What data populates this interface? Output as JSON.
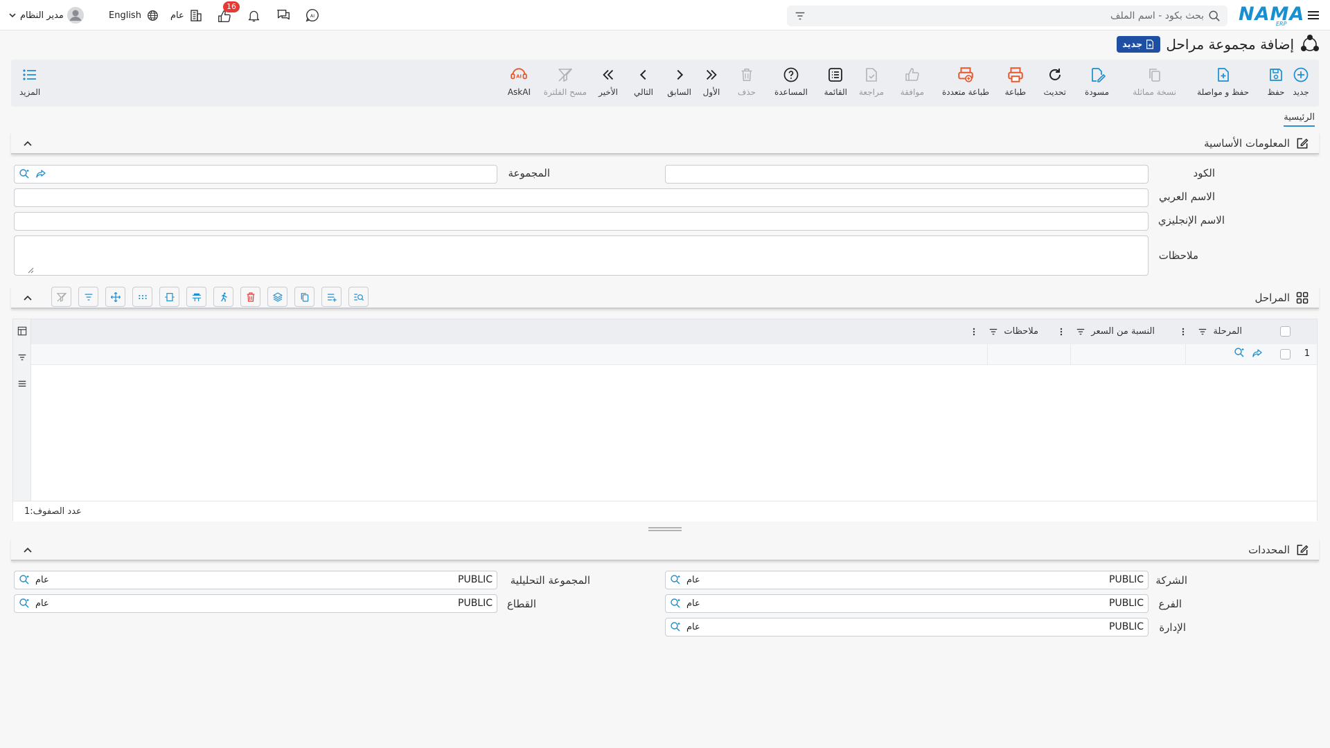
{
  "topbar": {
    "user_name": "مدير النظام",
    "language": "English",
    "scope": "عام",
    "notification_count": "16",
    "search_placeholder": "بحث بكود - اسم الملف",
    "logo_text": "NAMA",
    "logo_sub": "ERP"
  },
  "page": {
    "title": "إضافة مجموعة مراحل",
    "badge": "جديد"
  },
  "toolbar": {
    "new": "جديد",
    "save": "حفظ",
    "save_continue": "حفظ و مواصلة",
    "duplicate": "نسخة مماثلة",
    "draft": "مسودة",
    "refresh": "تحديث",
    "print": "طباعة",
    "multi_print": "طباعة متعددة",
    "approve": "موافقة",
    "review": "مراجعة",
    "list": "القائمة",
    "help": "المساعدة",
    "delete": "حذف",
    "first": "الأول",
    "previous": "السابق",
    "next": "التالي",
    "last": "الأخير",
    "clear_filter": "مسح الفلترة",
    "askai": "AskAI",
    "more": "المزيد"
  },
  "tabs": {
    "main": "الرئيسية"
  },
  "basic_info": {
    "title": "المعلومات الأساسية",
    "code_label": "الكود",
    "group_label": "المجموعة",
    "arabic_name_label": "الاسم العربي",
    "english_name_label": "الاسم الإنجليزي",
    "notes_label": "ملاحظات"
  },
  "stages": {
    "title": "المراحل",
    "columns": {
      "stage": "المرحلة",
      "price_ratio": "النسبة من السعر",
      "notes": "ملاحظات"
    },
    "row_number": "1",
    "row_count_label": "عدد الصفوف:",
    "row_count": "1"
  },
  "determinants": {
    "title": "المحددات",
    "company_label": "الشركة",
    "company_value": "PUBLIC",
    "company_tag": "عام",
    "branch_label": "الفرع",
    "branch_value": "PUBLIC",
    "branch_tag": "عام",
    "department_label": "الإدارة",
    "department_value": "PUBLIC",
    "department_tag": "عام",
    "analytic_group_label": "المجموعة التحليلية",
    "analytic_group_value": "PUBLIC",
    "analytic_group_tag": "عام",
    "sector_label": "القطاع",
    "sector_value": "PUBLIC",
    "sector_tag": "عام"
  },
  "colors": {
    "accent": "#1a8fd0",
    "badge": "#1f4fa3",
    "print_orange": "#e8572a",
    "notification_red": "#e53935"
  }
}
